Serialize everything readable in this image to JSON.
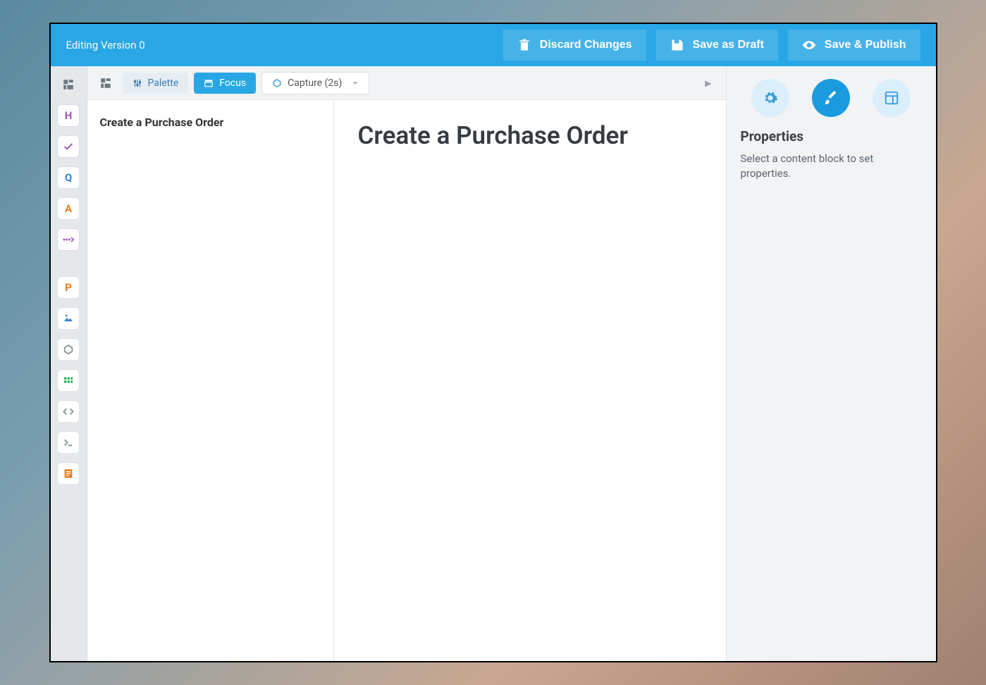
{
  "topbar": {
    "title": "Editing Version 0",
    "discard_label": "Discard Changes",
    "draft_label": "Save as Draft",
    "publish_label": "Save & Publish"
  },
  "toolbar": {
    "palette_label": "Palette",
    "focus_label": "Focus",
    "capture_label": "Capture (2s)"
  },
  "sidebar_tools": {
    "heading": "H",
    "question": "Q",
    "answer": "A",
    "paragraph": "P"
  },
  "outline": {
    "title": "Create a Purchase Order"
  },
  "canvas": {
    "heading": "Create a Purchase Order"
  },
  "properties": {
    "heading": "Properties",
    "empty_text": "Select a content block to set properties."
  }
}
